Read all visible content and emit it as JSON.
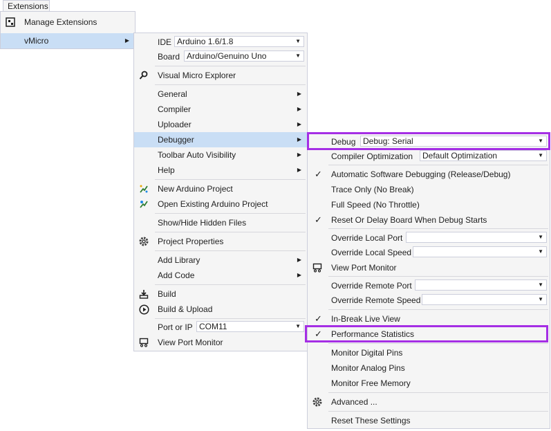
{
  "menubar": {
    "extensions_label": "Extensions"
  },
  "ext_menu": {
    "manage_label": "Manage Extensions",
    "vmicro_label": "vMicro"
  },
  "vmicro_menu": {
    "ide_label": "IDE",
    "ide_value": "Arduino 1.6/1.8",
    "board_label": "Board",
    "board_value": "Arduino/Genuino Uno",
    "explorer": "Visual Micro Explorer",
    "general": "General",
    "compiler": "Compiler",
    "uploader": "Uploader",
    "debugger": "Debugger",
    "toolbar_vis": "Toolbar Auto Visibility",
    "help": "Help",
    "new_project": "New Arduino Project",
    "open_project": "Open Existing Arduino Project",
    "show_hidden": "Show/Hide Hidden Files",
    "project_props": "Project Properties",
    "add_library": "Add Library",
    "add_code": "Add Code",
    "build": "Build",
    "build_upload": "Build & Upload",
    "port_label": "Port or IP",
    "port_value": "COM11",
    "port_monitor": "View Port Monitor"
  },
  "debug_menu": {
    "debug_label": "Debug",
    "debug_value": "Debug: Serial",
    "compiler_opt_label": "Compiler Optimization",
    "compiler_opt_value": "Default Optimization",
    "auto_sw_debug": "Automatic Software Debugging (Release/Debug)",
    "trace_only": "Trace Only (No Break)",
    "full_speed": "Full Speed (No Throttle)",
    "reset_delay": "Reset Or Delay Board When Debug Starts",
    "override_local_port": "Override Local Port",
    "override_local_speed": "Override Local Speed",
    "view_port_monitor": "View Port Monitor",
    "override_remote_port": "Override Remote Port",
    "override_remote_speed": "Override Remote Speed",
    "inbreak_live": "In-Break Live View",
    "perf_stats": "Performance Statistics",
    "mon_digital": "Monitor Digital Pins",
    "mon_analog": "Monitor Analog Pins",
    "mon_memory": "Monitor Free Memory",
    "advanced": "Advanced ...",
    "reset_settings": "Reset These Settings"
  },
  "colors": {
    "highlight_box": "#a52ee5",
    "hover": "#c9def5",
    "menu_bg": "#f5f5f5"
  }
}
